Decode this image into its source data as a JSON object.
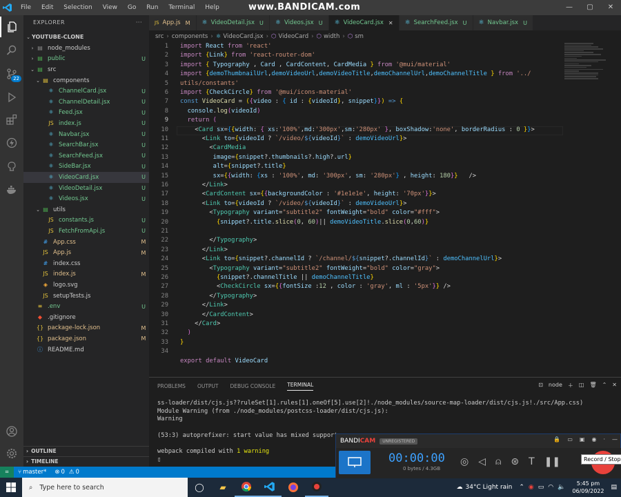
{
  "titlebar": {
    "menu": [
      "File",
      "Edit",
      "Selection",
      "View",
      "Go",
      "Run",
      "Terminal",
      "Help"
    ],
    "watermark": "www.BANDICAM.com",
    "controls": [
      "—",
      "▢",
      "✕"
    ]
  },
  "activity": {
    "badge": "22"
  },
  "sidebar": {
    "header": "EXPLORER",
    "more": "···",
    "root": "YOUTUBE-CLONE",
    "items": [
      {
        "name": "node_modules",
        "status": ""
      },
      {
        "name": "public",
        "status": "U"
      },
      {
        "name": "src",
        "status": ""
      },
      {
        "name": "components",
        "status": ""
      },
      {
        "name": "ChannelCard.jsx",
        "status": "U"
      },
      {
        "name": "ChannelDetail.jsx",
        "status": "U"
      },
      {
        "name": "Feed.jsx",
        "status": "U"
      },
      {
        "name": "index.js",
        "status": "U"
      },
      {
        "name": "Navbar.jsx",
        "status": "U"
      },
      {
        "name": "SearchBar.jsx",
        "status": "U"
      },
      {
        "name": "SearchFeed.jsx",
        "status": "U"
      },
      {
        "name": "SideBar.jsx",
        "status": "U"
      },
      {
        "name": "VideoCard.jsx",
        "status": "U"
      },
      {
        "name": "VideoDetail.jsx",
        "status": "U"
      },
      {
        "name": "Videos.jsx",
        "status": "U"
      },
      {
        "name": "utils",
        "status": ""
      },
      {
        "name": "constants.js",
        "status": "U"
      },
      {
        "name": "FetchFromApi.js",
        "status": "U"
      },
      {
        "name": "App.css",
        "status": "M"
      },
      {
        "name": "App.js",
        "status": "M"
      },
      {
        "name": "index.css",
        "status": ""
      },
      {
        "name": "index.js",
        "status": "M"
      },
      {
        "name": "logo.svg",
        "status": ""
      },
      {
        "name": "setupTests.js",
        "status": ""
      },
      {
        "name": ".env",
        "status": "U"
      },
      {
        "name": ".gitignore",
        "status": ""
      },
      {
        "name": "package-lock.json",
        "status": "M"
      },
      {
        "name": "package.json",
        "status": "M"
      },
      {
        "name": "README.md",
        "status": ""
      }
    ],
    "outline": "OUTLINE",
    "timeline": "TIMELINE"
  },
  "tabs": [
    {
      "label": "App.js",
      "mark": "M"
    },
    {
      "label": "VideoDetail.jsx",
      "mark": "U"
    },
    {
      "label": "Videos.jsx",
      "mark": "U"
    },
    {
      "label": "VideoCard.jsx",
      "mark": "U"
    },
    {
      "label": "SearchFeed.jsx",
      "mark": "U"
    },
    {
      "label": "Navbar.jsx",
      "mark": "U"
    }
  ],
  "breadcrumb": [
    "src",
    "components",
    "VideoCard.jsx",
    "VideoCard",
    "width",
    "sm"
  ],
  "editor": {
    "line_numbers": [
      "1",
      "2",
      "3",
      "4",
      "5",
      "6",
      "7",
      "8",
      "9",
      "10",
      "11",
      "12",
      "13",
      "14",
      "15",
      "16",
      "17",
      "18",
      "19",
      "20",
      "21",
      "22",
      "23",
      "24",
      "25",
      "26",
      "27",
      "28",
      "29",
      "30",
      "31",
      "32",
      "33",
      "34"
    ]
  },
  "panel": {
    "tabs": [
      "PROBLEMS",
      "OUTPUT",
      "DEBUG CONSOLE",
      "TERMINAL"
    ],
    "shell": "node",
    "lines": [
      "ss-loader/dist/cjs.js??ruleSet[1].rules[1].oneOf[5].use[2]!./node_modules/source-map-loader/dist/cjs.js!./src/App.css)",
      "Module Warning (from ./node_modules/postcss-loader/dist/cjs.js):",
      "Warning",
      "",
      "(53:3) autoprefixer: start value has mixed support, c",
      "",
      "webpack compiled with ",
      "1 warning"
    ]
  },
  "statusbar": {
    "branch": "master*",
    "errors": "0",
    "warnings": "0"
  },
  "taskbar": {
    "search_placeholder": "Type here to search",
    "weather": "34°C  Light rain",
    "time": "5:45 pm",
    "date": "06/09/2022"
  },
  "bandicam": {
    "brand_a": "BANDI",
    "brand_b": "CAM",
    "unregistered": "UNREGISTERED",
    "timer": "00:00:00",
    "size": "0 bytes / 4.3GB",
    "tooltip": "Record / Stop"
  }
}
